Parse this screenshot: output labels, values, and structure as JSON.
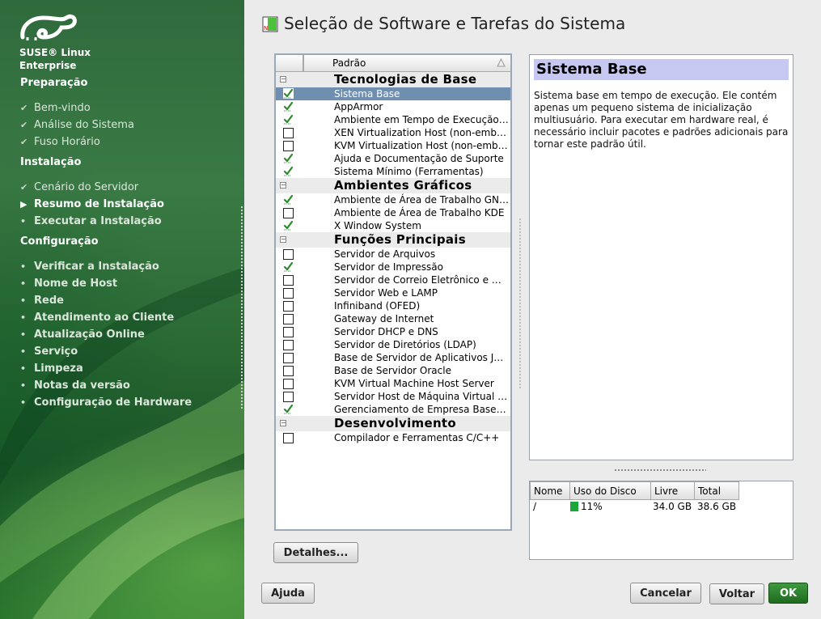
{
  "brand": {
    "line1": "SUSE® Linux",
    "line2": "Enterprise"
  },
  "colors": {
    "accent_green": "#2f7a34",
    "selection": "#6f8eb0",
    "detail_title_bg": "#c6c8f2",
    "ok_button": "#2a7d2a",
    "disk_bar": "#1fa63a"
  },
  "sidebar": {
    "sections": [
      {
        "title": "Preparação",
        "steps": [
          {
            "label": "Bem-vindo",
            "state": "done"
          },
          {
            "label": "Análise do Sistema",
            "state": "done"
          },
          {
            "label": "Fuso Horário",
            "state": "done"
          }
        ]
      },
      {
        "title": "Instalação",
        "steps": [
          {
            "label": "Cenário do Servidor",
            "state": "done"
          },
          {
            "label": "Resumo de Instalação",
            "state": "current"
          },
          {
            "label": "Executar a Instalação",
            "state": "todo"
          }
        ]
      },
      {
        "title": "Configuração",
        "steps": [
          {
            "label": "Verificar a Instalação",
            "state": "todo"
          },
          {
            "label": "Nome de Host",
            "state": "todo"
          },
          {
            "label": "Rede",
            "state": "todo"
          },
          {
            "label": "Atendimento ao Cliente",
            "state": "todo"
          },
          {
            "label": "Atualização Online",
            "state": "todo"
          },
          {
            "label": "Serviço",
            "state": "todo"
          },
          {
            "label": "Limpeza",
            "state": "todo"
          },
          {
            "label": "Notas da versão",
            "state": "todo"
          },
          {
            "label": "Configuração de Hardware",
            "state": "todo"
          }
        ]
      }
    ]
  },
  "page": {
    "title": "Seleção de Software e Tarefas do Sistema",
    "title_icon": "software-package-icon"
  },
  "patterns": {
    "column_header": "Padrão",
    "groups": [
      {
        "title": "Tecnologias de Base",
        "items": [
          {
            "label": "Sistema Base",
            "state": "checked",
            "selected": true
          },
          {
            "label": "AppArmor",
            "state": "checked"
          },
          {
            "label": "Ambiente em Tempo de Execução Java",
            "state": "checked"
          },
          {
            "label": "XEN Virtualization Host (non-embedded)",
            "state": "unchecked"
          },
          {
            "label": "KVM Virtualization Host (non-embedded)",
            "state": "unchecked"
          },
          {
            "label": "Ajuda e Documentação de Suporte",
            "state": "checked"
          },
          {
            "label": "Sistema Mínimo (Ferramentas)",
            "state": "checked"
          }
        ]
      },
      {
        "title": "Ambientes Gráficos",
        "items": [
          {
            "label": "Ambiente de Área de Trabalho GNOME",
            "state": "checked"
          },
          {
            "label": "Ambiente de Área de Trabalho KDE",
            "state": "unchecked"
          },
          {
            "label": "X Window System",
            "state": "checked"
          }
        ]
      },
      {
        "title": "Funções Principais",
        "items": [
          {
            "label": "Servidor de Arquivos",
            "state": "unchecked"
          },
          {
            "label": "Servidor de Impressão",
            "state": "checked"
          },
          {
            "label": "Servidor de Correio Eletrônico e Mensagens",
            "state": "unchecked"
          },
          {
            "label": "Servidor Web e LAMP",
            "state": "unchecked"
          },
          {
            "label": "Infiniband (OFED)",
            "state": "unchecked"
          },
          {
            "label": "Gateway de Internet",
            "state": "unchecked"
          },
          {
            "label": "Servidor DHCP e DNS",
            "state": "unchecked"
          },
          {
            "label": "Servidor de Diretórios (LDAP)",
            "state": "unchecked"
          },
          {
            "label": "Base de Servidor de Aplicativos Java",
            "state": "unchecked"
          },
          {
            "label": "Base de Servidor Oracle",
            "state": "unchecked"
          },
          {
            "label": "KVM Virtual Machine Host Server",
            "state": "unchecked"
          },
          {
            "label": "Servidor Host de Máquina Virtual Xen",
            "state": "unchecked"
          },
          {
            "label": "Gerenciamento de Empresa Baseado na Web",
            "state": "checked"
          }
        ]
      },
      {
        "title": "Desenvolvimento",
        "items": [
          {
            "label": "Compilador e Ferramentas C/C++",
            "state": "unchecked"
          }
        ]
      }
    ]
  },
  "details": {
    "title": "Sistema Base",
    "text": "Sistema base em tempo de execução. Ele contém apenas um pequeno sistema de inicialização multiusuário. Para executar em hardware real, é necessário incluir pacotes e padrões adicionais para tornar este padrão útil."
  },
  "disk": {
    "headers": [
      "Nome",
      "Uso do Disco",
      "Livre",
      "Total"
    ],
    "rows": [
      {
        "name": "/",
        "usage": "11%",
        "usage_fraction": 0.11,
        "free": "34.0 GB",
        "total": "38.6 GB"
      }
    ]
  },
  "buttons": {
    "details": "Detalhes...",
    "help": "Ajuda",
    "cancel": "Cancelar",
    "back": "Voltar",
    "ok": "OK"
  }
}
